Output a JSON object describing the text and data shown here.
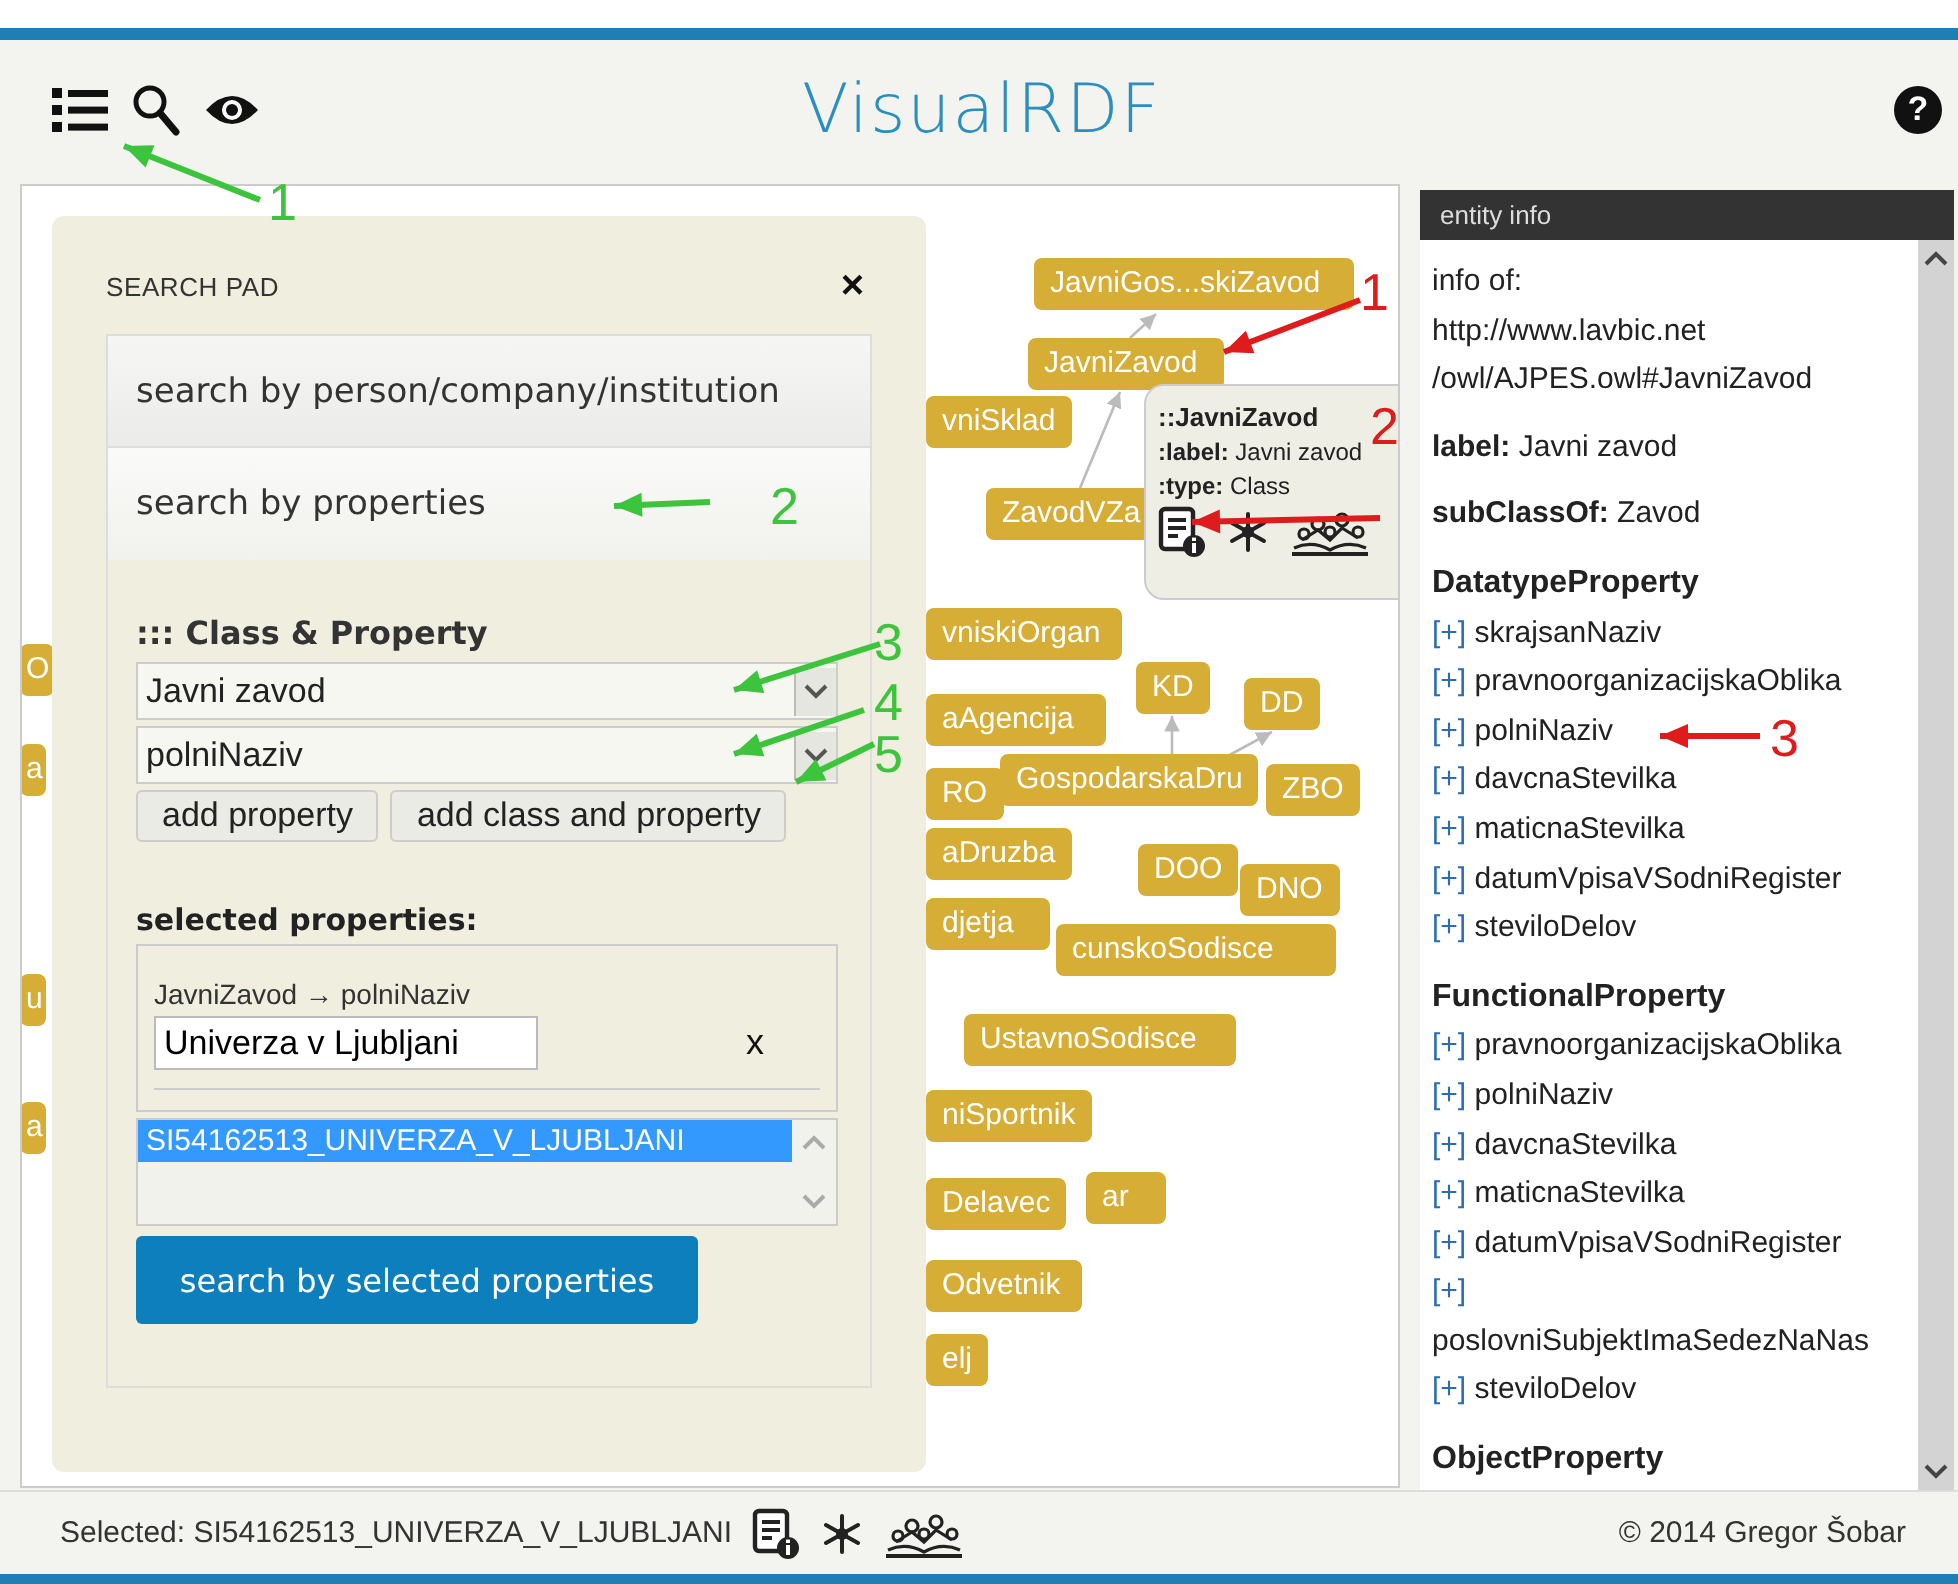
{
  "header": {
    "title": "VisualRDF",
    "help": "?"
  },
  "graph": {
    "nodes": [
      {
        "label": "JavniGos...skiZavod"
      },
      {
        "label": "JavniZavod"
      },
      {
        "label": "vniSklad"
      },
      {
        "label": "ZavodVZa"
      },
      {
        "label": "vniskiOrgan"
      },
      {
        "label": "KD"
      },
      {
        "label": "DD"
      },
      {
        "label": "aAgencija"
      },
      {
        "label": "RO"
      },
      {
        "label": "GospodarskaDru"
      },
      {
        "label": "ZBO"
      },
      {
        "label": "aDruzba"
      },
      {
        "label": "DOO"
      },
      {
        "label": "DNO"
      },
      {
        "label": "cunskoSodisce"
      },
      {
        "label": "djetja"
      },
      {
        "label": "UstavnoSodisce"
      },
      {
        "label": "niSportnik"
      },
      {
        "label": "Delavec"
      },
      {
        "label": "ar"
      },
      {
        "label": "Odvetnik"
      },
      {
        "label": "elj"
      },
      {
        "label": "O"
      },
      {
        "label": "a"
      },
      {
        "label": "u"
      },
      {
        "label": "a"
      }
    ]
  },
  "search_pad": {
    "title": "SEARCH PAD",
    "close": "×",
    "sections": [
      {
        "label": "search by person/company/institution",
        "selected": false
      },
      {
        "label": "search by properties",
        "selected": true
      }
    ],
    "class_property": {
      "heading": "::: Class & Property",
      "class_value": "Javni zavod",
      "property_value": "polniNaziv",
      "buttons": [
        "add property",
        "add class and property"
      ]
    },
    "selected_properties": {
      "heading": "selected properties:",
      "path": "JavniZavod → polniNaziv",
      "value": "Univerza v Ljubljani",
      "remove": "x",
      "results": [
        {
          "label": "SI54162513_UNIVERZA_V_LJUBLJANI",
          "selected": true
        }
      ],
      "search_button": "search by selected properties"
    }
  },
  "tooltip": {
    "name": "::JavniZavod",
    "label_key": ":label:",
    "label": "Javni zavod",
    "type_key": ":type:",
    "type": "Class",
    "actions": [
      {
        "kind": "details"
      },
      {
        "kind": "expand"
      },
      {
        "kind": "tree"
      }
    ]
  },
  "entity_info": {
    "title": "entity info",
    "info_of": "info of:",
    "uri": [
      "http://www.lavbic.net",
      "/owl/AJPES.owl#JavniZavod"
    ],
    "label_key": "label:",
    "label": "Javni zavod",
    "subclass_key": "subClassOf:",
    "subclass": "Zavod",
    "groups": [
      {
        "name": "DatatypeProperty",
        "items": [
          {
            "expand": "[+]",
            "name": "skrajsanNaziv"
          },
          {
            "expand": "[+]",
            "name": "pravnoorganizacijskaOblika"
          },
          {
            "expand": "[+]",
            "name": "polniNaziv"
          },
          {
            "expand": "[+]",
            "name": "davcnaStevilka"
          },
          {
            "expand": "[+]",
            "name": "maticnaStevilka"
          },
          {
            "expand": "[+]",
            "name": "datumVpisaVSodniRegister"
          },
          {
            "expand": "[+]",
            "name": "steviloDelov"
          }
        ]
      },
      {
        "name": "FunctionalProperty",
        "items": [
          {
            "expand": "[+]",
            "name": "pravnoorganizacijskaOblika"
          },
          {
            "expand": "[+]",
            "name": "polniNaziv"
          },
          {
            "expand": "[+]",
            "name": "davcnaStevilka"
          },
          {
            "expand": "[+]",
            "name": "maticnaStevilka"
          },
          {
            "expand": "[+]",
            "name": "datumVpisaVSodniRegister"
          },
          {
            "expand": "[+]",
            "name": "poslovniSubjektImaSedezNaNas",
            "wrapped": true
          },
          {
            "expand": "[+]",
            "name": "steviloDelov"
          }
        ]
      },
      {
        "name": "ObjectProperty"
      }
    ]
  },
  "status_bar": {
    "selected": "Selected: SI54162513_UNIVERZA_V_LJUBLJANI",
    "actions": [
      {
        "kind": "details"
      },
      {
        "kind": "expand"
      },
      {
        "kind": "tree"
      }
    ],
    "copyright": "© 2014 Gregor Šobar"
  },
  "annotations": [
    {
      "number": "1",
      "color": "#3cc43c"
    },
    {
      "number": "2",
      "color": "#3cc43c"
    },
    {
      "number": "3",
      "color": "#3cc43c"
    },
    {
      "number": "4",
      "color": "#3cc43c"
    },
    {
      "number": "5",
      "color": "#3cc43c"
    },
    {
      "number": "1",
      "color": "#e01b1b"
    },
    {
      "number": "2",
      "color": "#e01b1b"
    },
    {
      "number": "3",
      "color": "#e01b1b"
    }
  ]
}
